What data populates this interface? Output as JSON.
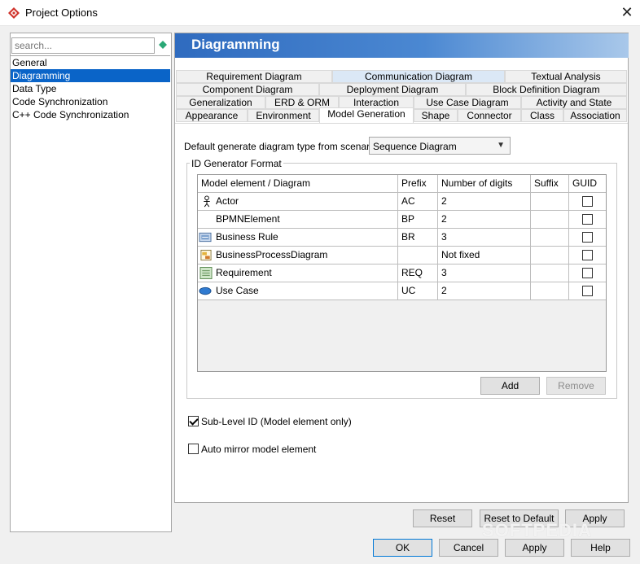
{
  "window": {
    "title": "Project Options",
    "close_glyph": "✕"
  },
  "sidebar": {
    "search_placeholder": "search...",
    "items": [
      {
        "label": "General",
        "selected": false
      },
      {
        "label": "Diagramming",
        "selected": true
      },
      {
        "label": "Data Type",
        "selected": false
      },
      {
        "label": "Code Synchronization",
        "selected": false
      },
      {
        "label": "C++ Code Synchronization",
        "selected": false
      }
    ]
  },
  "main": {
    "heading": "Diagramming",
    "tabs": {
      "row1": [
        "Requirement Diagram",
        "Communication Diagram",
        "Textual Analysis"
      ],
      "row2": [
        "Component Diagram",
        "Deployment Diagram",
        "Block Definition Diagram"
      ],
      "row3": [
        "Generalization",
        "ERD & ORM",
        "Interaction",
        "Use Case Diagram",
        "Activity and State"
      ],
      "row4": [
        "Appearance",
        "Environment",
        "Model Generation",
        "Shape",
        "Connector",
        "Class",
        "Association"
      ],
      "active": "Model Generation"
    },
    "scenario_label": "Default generate diagram type from scenario :",
    "scenario_value": "Sequence Diagram",
    "id_group_title": "ID Generator Format",
    "table": {
      "headers": [
        "Model element / Diagram",
        "Prefix",
        "Number of digits",
        "Suffix",
        "GUID"
      ],
      "rows": [
        {
          "icon": "actor-icon",
          "name": "Actor",
          "prefix": "AC",
          "digits": "2",
          "suffix": "",
          "guid": false
        },
        {
          "icon": "none",
          "name": "BPMNElement",
          "prefix": "BP",
          "digits": "2",
          "suffix": "",
          "guid": false
        },
        {
          "icon": "business-rule-icon",
          "name": "Business Rule",
          "prefix": "BR",
          "digits": "3",
          "suffix": "",
          "guid": false
        },
        {
          "icon": "business-process-diagram-icon",
          "name": "BusinessProcessDiagram",
          "prefix": "",
          "digits": "Not fixed",
          "suffix": "",
          "guid": false
        },
        {
          "icon": "requirement-icon",
          "name": "Requirement",
          "prefix": "REQ",
          "digits": "3",
          "suffix": "",
          "guid": false
        },
        {
          "icon": "use-case-icon",
          "name": "Use Case",
          "prefix": "UC",
          "digits": "2",
          "suffix": "",
          "guid": false
        }
      ]
    },
    "add_label": "Add",
    "remove_label": "Remove",
    "sublevel_label": "Sub-Level ID (Model element only)",
    "sublevel_checked": true,
    "automirror_label": "Auto mirror model element",
    "automirror_checked": false,
    "reset_label": "Reset",
    "reset_default_label": "Reset to Default",
    "apply_label": "Apply"
  },
  "footer": {
    "ok": "OK",
    "cancel": "Cancel",
    "apply": "Apply",
    "help": "Help"
  },
  "watermark": "SOFTPEDIA"
}
